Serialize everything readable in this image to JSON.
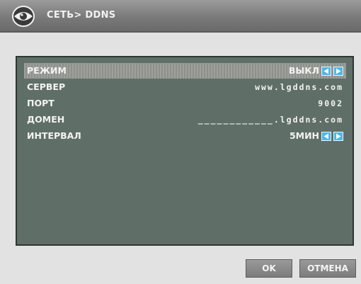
{
  "header": {
    "title": "СЕТЬ> DDNS",
    "logo_icon": "eye-logo-icon"
  },
  "settings": [
    {
      "label": "РЕЖИМ",
      "value": "ВЫКЛ",
      "has_arrows": true,
      "selected": true
    },
    {
      "label": "СЕРВЕР",
      "value": "www.lgddns.com",
      "has_arrows": false,
      "selected": false
    },
    {
      "label": "ПОРТ",
      "value": "9002",
      "has_arrows": false,
      "selected": false
    },
    {
      "label": "ДОМЕН",
      "value": "____________.lgddns.com",
      "has_arrows": false,
      "selected": false
    },
    {
      "label": "ИНТЕРВАЛ",
      "value": "5МИН",
      "has_arrows": true,
      "selected": false
    }
  ],
  "buttons": {
    "ok": "OK",
    "cancel": "ОТМЕНА"
  },
  "colors": {
    "panel": "#5f6f68",
    "arrow_button": "#4fb6e6",
    "header": "#7a7a7a"
  }
}
